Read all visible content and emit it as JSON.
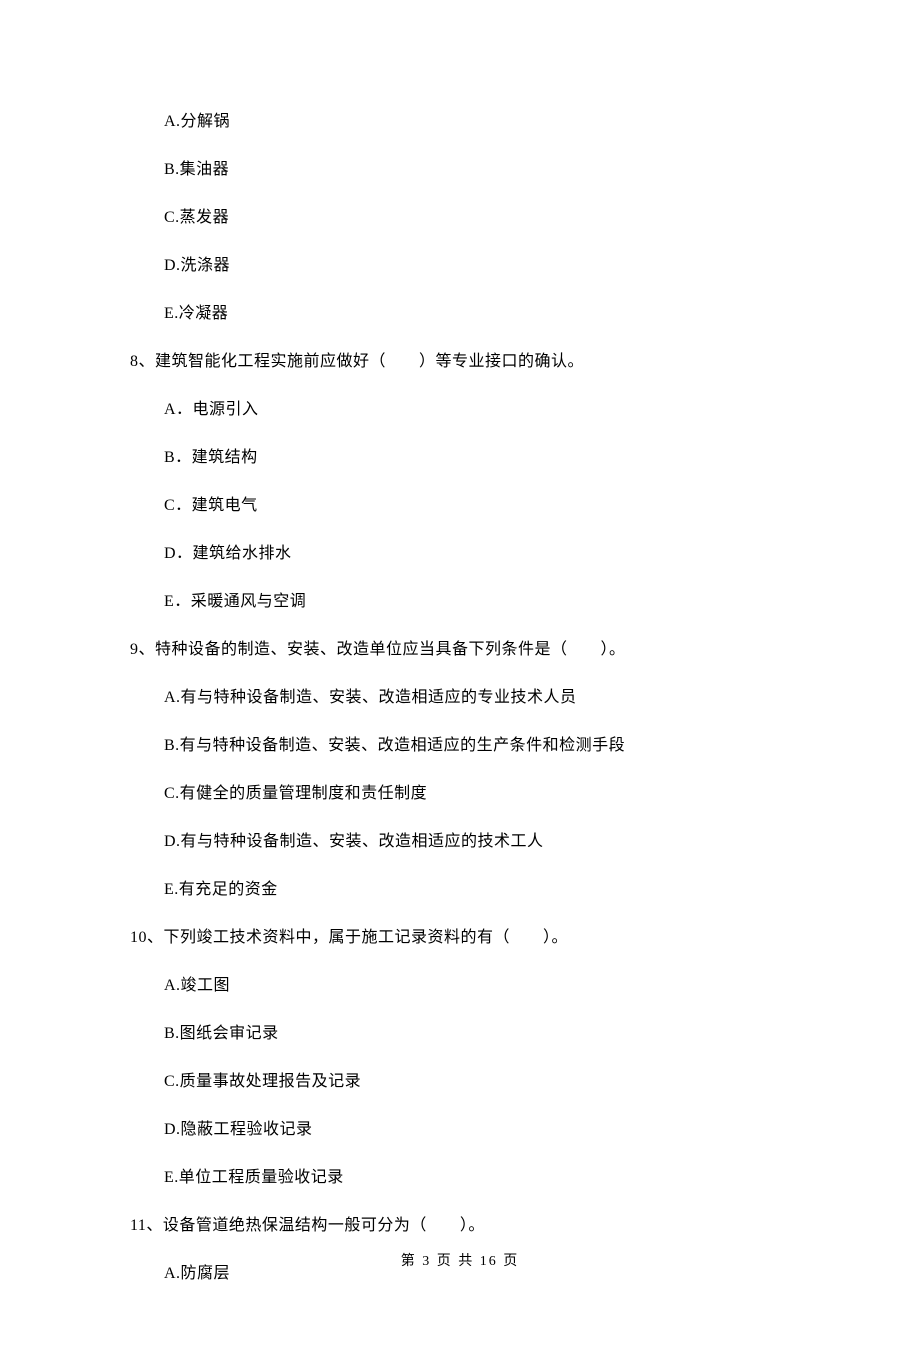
{
  "q7": {
    "options": {
      "a": "A.分解锅",
      "b": "B.集油器",
      "c": "C.蒸发器",
      "d": "D.洗涤器",
      "e": "E.冷凝器"
    }
  },
  "q8": {
    "stem": "8、建筑智能化工程实施前应做好（　　）等专业接口的确认。",
    "options": {
      "a": "A．电源引入",
      "b": "B．建筑结构",
      "c": "C．建筑电气",
      "d": "D．建筑给水排水",
      "e": "E．采暖通风与空调"
    }
  },
  "q9": {
    "stem": "9、特种设备的制造、安装、改造单位应当具备下列条件是（　　）。",
    "options": {
      "a": "A.有与特种设备制造、安装、改造相适应的专业技术人员",
      "b": "B.有与特种设备制造、安装、改造相适应的生产条件和检测手段",
      "c": "C.有健全的质量管理制度和责任制度",
      "d": "D.有与特种设备制造、安装、改造相适应的技术工人",
      "e": "E.有充足的资金"
    }
  },
  "q10": {
    "stem": "10、下列竣工技术资料中，属于施工记录资料的有（　　）。",
    "options": {
      "a": "A.竣工图",
      "b": "B.图纸会审记录",
      "c": "C.质量事故处理报告及记录",
      "d": "D.隐蔽工程验收记录",
      "e": "E.单位工程质量验收记录"
    }
  },
  "q11": {
    "stem": "11、设备管道绝热保温结构一般可分为（　　）。",
    "options": {
      "a": "A.防腐层"
    }
  },
  "footer": "第 3 页 共 16 页"
}
